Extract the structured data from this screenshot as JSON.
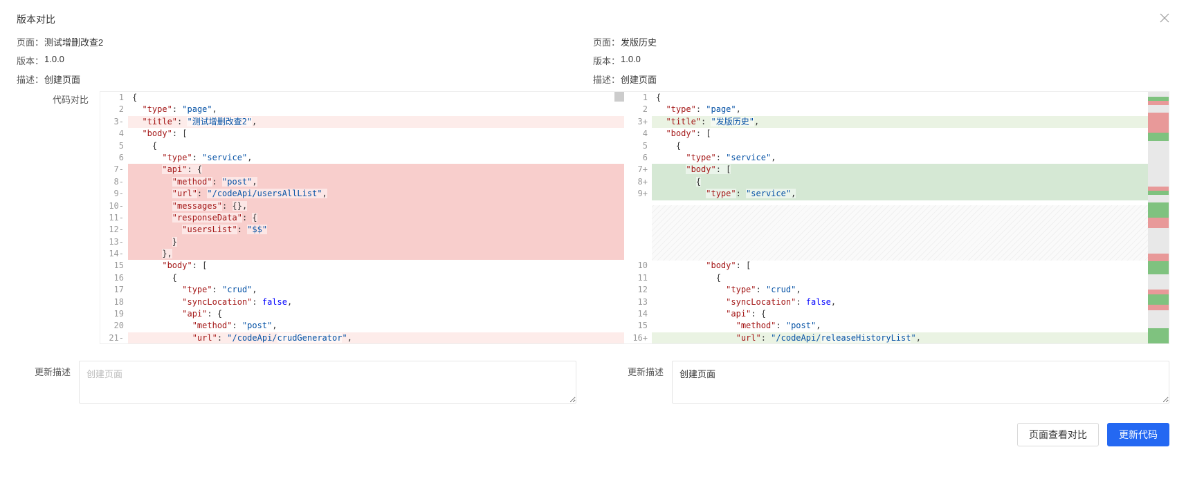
{
  "dialog": {
    "title": "版本对比",
    "close_icon": "close-icon"
  },
  "left": {
    "page_label": "页面：",
    "page_value": "测试增删改查2",
    "version_label": "版本：",
    "version_value": "1.0.0",
    "desc_label": "描述：",
    "desc_value": "创建页面"
  },
  "right": {
    "page_label": "页面：",
    "page_value": "发版历史",
    "version_label": "版本：",
    "version_value": "1.0.0",
    "desc_label": "描述：",
    "desc_value": "创建页面"
  },
  "diff_label": "代码对比",
  "left_code": {
    "lines": [
      {
        "n": "1",
        "cls": "",
        "seg": [
          {
            "t": "{",
            "c": "tok-pun"
          }
        ]
      },
      {
        "n": "2",
        "cls": "",
        "seg": [
          {
            "t": "  ",
            "c": ""
          },
          {
            "t": "\"type\"",
            "c": "tok-key"
          },
          {
            "t": ": ",
            "c": "tok-pun"
          },
          {
            "t": "\"page\"",
            "c": "tok-str"
          },
          {
            "t": ",",
            "c": "tok-pun"
          }
        ]
      },
      {
        "n": "3-",
        "cls": "hl-del-light",
        "seg": [
          {
            "t": "  ",
            "c": ""
          },
          {
            "t": "\"title\"",
            "c": "tok-key"
          },
          {
            "t": ": ",
            "c": "tok-pun"
          },
          {
            "t": "\"测试增删改查2\"",
            "c": "tok-str tok-hlword"
          },
          {
            "t": ",",
            "c": "tok-pun"
          }
        ]
      },
      {
        "n": "4",
        "cls": "",
        "seg": [
          {
            "t": "  ",
            "c": ""
          },
          {
            "t": "\"body\"",
            "c": "tok-key"
          },
          {
            "t": ": [",
            "c": "tok-pun"
          }
        ]
      },
      {
        "n": "5",
        "cls": "",
        "seg": [
          {
            "t": "    {",
            "c": "tok-pun"
          }
        ]
      },
      {
        "n": "6",
        "cls": "",
        "seg": [
          {
            "t": "      ",
            "c": ""
          },
          {
            "t": "\"type\"",
            "c": "tok-key"
          },
          {
            "t": ": ",
            "c": "tok-pun"
          },
          {
            "t": "\"service\"",
            "c": "tok-str"
          },
          {
            "t": ",",
            "c": "tok-pun"
          }
        ]
      },
      {
        "n": "7-",
        "cls": "hl-del",
        "seg": [
          {
            "t": "      ",
            "c": ""
          },
          {
            "t": "\"api\"",
            "c": "tok-key tok-hlword"
          },
          {
            "t": ": {",
            "c": "tok-pun tok-hlword"
          }
        ]
      },
      {
        "n": "8-",
        "cls": "hl-del",
        "seg": [
          {
            "t": "        ",
            "c": ""
          },
          {
            "t": "\"method\"",
            "c": "tok-key tok-hlword"
          },
          {
            "t": ": ",
            "c": "tok-pun"
          },
          {
            "t": "\"post\"",
            "c": "tok-str tok-hlword"
          },
          {
            "t": ",",
            "c": "tok-pun tok-hlword"
          }
        ]
      },
      {
        "n": "9-",
        "cls": "hl-del",
        "seg": [
          {
            "t": "        ",
            "c": ""
          },
          {
            "t": "\"url\"",
            "c": "tok-key tok-hlword"
          },
          {
            "t": ": ",
            "c": "tok-pun"
          },
          {
            "t": "\"/codeApi/usersAllList\"",
            "c": "tok-str tok-hlword"
          },
          {
            "t": ",",
            "c": "tok-pun tok-hlword"
          }
        ]
      },
      {
        "n": "10-",
        "cls": "hl-del",
        "seg": [
          {
            "t": "        ",
            "c": ""
          },
          {
            "t": "\"messages\"",
            "c": "tok-key tok-hlword"
          },
          {
            "t": ": ",
            "c": "tok-pun"
          },
          {
            "t": "{},",
            "c": "tok-pun tok-hlword"
          }
        ]
      },
      {
        "n": "11-",
        "cls": "hl-del",
        "seg": [
          {
            "t": "        ",
            "c": ""
          },
          {
            "t": "\"responseData\"",
            "c": "tok-key tok-hlword"
          },
          {
            "t": ": ",
            "c": "tok-pun"
          },
          {
            "t": "{",
            "c": "tok-pun tok-hlword"
          }
        ]
      },
      {
        "n": "12-",
        "cls": "hl-del",
        "seg": [
          {
            "t": "          ",
            "c": ""
          },
          {
            "t": "\"usersList\"",
            "c": "tok-key tok-hlword"
          },
          {
            "t": ": ",
            "c": "tok-pun"
          },
          {
            "t": "\"$$\"",
            "c": "tok-str tok-hlword"
          }
        ]
      },
      {
        "n": "13-",
        "cls": "hl-del",
        "seg": [
          {
            "t": "        ",
            "c": ""
          },
          {
            "t": "}",
            "c": "tok-pun tok-hlword"
          }
        ]
      },
      {
        "n": "14-",
        "cls": "hl-del",
        "seg": [
          {
            "t": "      ",
            "c": ""
          },
          {
            "t": "},",
            "c": "tok-pun tok-hlword"
          }
        ]
      },
      {
        "n": "15",
        "cls": "",
        "seg": [
          {
            "t": "      ",
            "c": ""
          },
          {
            "t": "\"body\"",
            "c": "tok-key"
          },
          {
            "t": ": [",
            "c": "tok-pun"
          }
        ]
      },
      {
        "n": "16",
        "cls": "",
        "seg": [
          {
            "t": "        {",
            "c": "tok-pun"
          }
        ]
      },
      {
        "n": "17",
        "cls": "",
        "seg": [
          {
            "t": "          ",
            "c": ""
          },
          {
            "t": "\"type\"",
            "c": "tok-key"
          },
          {
            "t": ": ",
            "c": "tok-pun"
          },
          {
            "t": "\"crud\"",
            "c": "tok-str"
          },
          {
            "t": ",",
            "c": "tok-pun"
          }
        ]
      },
      {
        "n": "18",
        "cls": "",
        "seg": [
          {
            "t": "          ",
            "c": ""
          },
          {
            "t": "\"syncLocation\"",
            "c": "tok-key"
          },
          {
            "t": ": ",
            "c": "tok-pun"
          },
          {
            "t": "false",
            "c": "tok-false"
          },
          {
            "t": ",",
            "c": "tok-pun"
          }
        ]
      },
      {
        "n": "19",
        "cls": "",
        "seg": [
          {
            "t": "          ",
            "c": ""
          },
          {
            "t": "\"api\"",
            "c": "tok-key"
          },
          {
            "t": ": {",
            "c": "tok-pun"
          }
        ]
      },
      {
        "n": "20",
        "cls": "",
        "seg": [
          {
            "t": "            ",
            "c": ""
          },
          {
            "t": "\"method\"",
            "c": "tok-key"
          },
          {
            "t": ": ",
            "c": "tok-pun"
          },
          {
            "t": "\"post\"",
            "c": "tok-str"
          },
          {
            "t": ",",
            "c": "tok-pun"
          }
        ]
      },
      {
        "n": "21-",
        "cls": "hl-del-light",
        "seg": [
          {
            "t": "            ",
            "c": ""
          },
          {
            "t": "\"url\"",
            "c": "tok-key"
          },
          {
            "t": ": ",
            "c": "tok-pun"
          },
          {
            "t": "\"/codeApi/",
            "c": "tok-str"
          },
          {
            "t": "crudGenerator",
            "c": "tok-str tok-hlword"
          },
          {
            "t": "\"",
            "c": "tok-str"
          },
          {
            "t": ",",
            "c": "tok-pun"
          }
        ]
      }
    ]
  },
  "right_code": {
    "lines": [
      {
        "n": "1",
        "cls": "",
        "seg": [
          {
            "t": "{",
            "c": "tok-pun"
          }
        ]
      },
      {
        "n": "2",
        "cls": "",
        "seg": [
          {
            "t": "  ",
            "c": ""
          },
          {
            "t": "\"type\"",
            "c": "tok-key"
          },
          {
            "t": ": ",
            "c": "tok-pun"
          },
          {
            "t": "\"page\"",
            "c": "tok-str"
          },
          {
            "t": ",",
            "c": "tok-pun"
          }
        ]
      },
      {
        "n": "3+",
        "cls": "hl-ins-light",
        "seg": [
          {
            "t": "  ",
            "c": ""
          },
          {
            "t": "\"title\"",
            "c": "tok-key"
          },
          {
            "t": ": ",
            "c": "tok-pun"
          },
          {
            "t": "\"发版历史\"",
            "c": "tok-str tok-hlword"
          },
          {
            "t": ",",
            "c": "tok-pun"
          }
        ]
      },
      {
        "n": "4",
        "cls": "",
        "seg": [
          {
            "t": "  ",
            "c": ""
          },
          {
            "t": "\"body\"",
            "c": "tok-key"
          },
          {
            "t": ": [",
            "c": "tok-pun"
          }
        ]
      },
      {
        "n": "5",
        "cls": "",
        "seg": [
          {
            "t": "    {",
            "c": "tok-pun"
          }
        ]
      },
      {
        "n": "6",
        "cls": "",
        "seg": [
          {
            "t": "      ",
            "c": ""
          },
          {
            "t": "\"type\"",
            "c": "tok-key"
          },
          {
            "t": ": ",
            "c": "tok-pun"
          },
          {
            "t": "\"service\"",
            "c": "tok-str"
          },
          {
            "t": ",",
            "c": "tok-pun"
          }
        ]
      },
      {
        "n": "7+",
        "cls": "hl-ins",
        "seg": [
          {
            "t": "      ",
            "c": ""
          },
          {
            "t": "\"body\"",
            "c": "tok-key tok-hlword"
          },
          {
            "t": ": [",
            "c": "tok-pun tok-hlword"
          }
        ]
      },
      {
        "n": "8+",
        "cls": "hl-ins",
        "seg": [
          {
            "t": "        ",
            "c": ""
          },
          {
            "t": "{",
            "c": "tok-pun tok-hlword"
          }
        ]
      },
      {
        "n": "9+",
        "cls": "hl-ins",
        "seg": [
          {
            "t": "          ",
            "c": ""
          },
          {
            "t": "\"type\"",
            "c": "tok-key tok-hlword"
          },
          {
            "t": ": ",
            "c": "tok-pun"
          },
          {
            "t": "\"service\"",
            "c": "tok-str tok-hlword"
          },
          {
            "t": ",",
            "c": "tok-pun tok-hlword"
          }
        ]
      },
      {
        "n": "",
        "cls": "gap",
        "seg": []
      },
      {
        "n": "",
        "cls": "gap",
        "seg": []
      },
      {
        "n": "",
        "cls": "gap",
        "seg": []
      },
      {
        "n": "",
        "cls": "gap",
        "seg": []
      },
      {
        "n": "",
        "cls": "gap",
        "seg": []
      },
      {
        "n": "10",
        "cls": "",
        "seg": [
          {
            "t": "          ",
            "c": ""
          },
          {
            "t": "\"body\"",
            "c": "tok-key"
          },
          {
            "t": ": [",
            "c": "tok-pun"
          }
        ]
      },
      {
        "n": "11",
        "cls": "",
        "seg": [
          {
            "t": "            {",
            "c": "tok-pun"
          }
        ]
      },
      {
        "n": "12",
        "cls": "",
        "seg": [
          {
            "t": "              ",
            "c": ""
          },
          {
            "t": "\"type\"",
            "c": "tok-key"
          },
          {
            "t": ": ",
            "c": "tok-pun"
          },
          {
            "t": "\"crud\"",
            "c": "tok-str"
          },
          {
            "t": ",",
            "c": "tok-pun"
          }
        ]
      },
      {
        "n": "13",
        "cls": "",
        "seg": [
          {
            "t": "              ",
            "c": ""
          },
          {
            "t": "\"syncLocation\"",
            "c": "tok-key"
          },
          {
            "t": ": ",
            "c": "tok-pun"
          },
          {
            "t": "false",
            "c": "tok-false"
          },
          {
            "t": ",",
            "c": "tok-pun"
          }
        ]
      },
      {
        "n": "14",
        "cls": "",
        "seg": [
          {
            "t": "              ",
            "c": ""
          },
          {
            "t": "\"api\"",
            "c": "tok-key"
          },
          {
            "t": ": {",
            "c": "tok-pun"
          }
        ]
      },
      {
        "n": "15",
        "cls": "",
        "seg": [
          {
            "t": "                ",
            "c": ""
          },
          {
            "t": "\"method\"",
            "c": "tok-key"
          },
          {
            "t": ": ",
            "c": "tok-pun"
          },
          {
            "t": "\"post\"",
            "c": "tok-str"
          },
          {
            "t": ",",
            "c": "tok-pun"
          }
        ]
      },
      {
        "n": "16+",
        "cls": "hl-ins-light",
        "seg": [
          {
            "t": "                ",
            "c": ""
          },
          {
            "t": "\"url\"",
            "c": "tok-key"
          },
          {
            "t": ": ",
            "c": "tok-pun"
          },
          {
            "t": "\"/codeApi/",
            "c": "tok-str"
          },
          {
            "t": "releaseHistoryList",
            "c": "tok-str tok-hlword"
          },
          {
            "t": "\"",
            "c": "tok-str"
          },
          {
            "t": ",",
            "c": "tok-pun"
          }
        ]
      }
    ]
  },
  "overview_segments": [
    {
      "h": 2,
      "c": "#e8e8e8"
    },
    {
      "h": 1.5,
      "c": "#7fc27f"
    },
    {
      "h": 1.5,
      "c": "#e89999"
    },
    {
      "h": 3,
      "c": "#e8e8e8"
    },
    {
      "h": 8,
      "c": "#e89999"
    },
    {
      "h": 3,
      "c": "#7fc27f"
    },
    {
      "h": 18,
      "c": "#e8e8e8"
    },
    {
      "h": 1.5,
      "c": "#e89999"
    },
    {
      "h": 1.5,
      "c": "#7fc27f"
    },
    {
      "h": 3,
      "c": "#e8e8e8"
    },
    {
      "h": 6,
      "c": "#7fc27f"
    },
    {
      "h": 4,
      "c": "#e89999"
    },
    {
      "h": 10,
      "c": "#e8e8e8"
    },
    {
      "h": 3,
      "c": "#e89999"
    },
    {
      "h": 5,
      "c": "#7fc27f"
    },
    {
      "h": 6,
      "c": "#e8e8e8"
    },
    {
      "h": 2,
      "c": "#e89999"
    },
    {
      "h": 4,
      "c": "#7fc27f"
    },
    {
      "h": 2,
      "c": "#e89999"
    },
    {
      "h": 7,
      "c": "#e8e8e8"
    },
    {
      "h": 6,
      "c": "#7fc27f"
    }
  ],
  "update_desc": {
    "left_label": "更新描述",
    "left_placeholder": "创建页面",
    "right_label": "更新描述",
    "right_value": "创建页面"
  },
  "buttons": {
    "compare": "页面查看对比",
    "update": "更新代码"
  }
}
